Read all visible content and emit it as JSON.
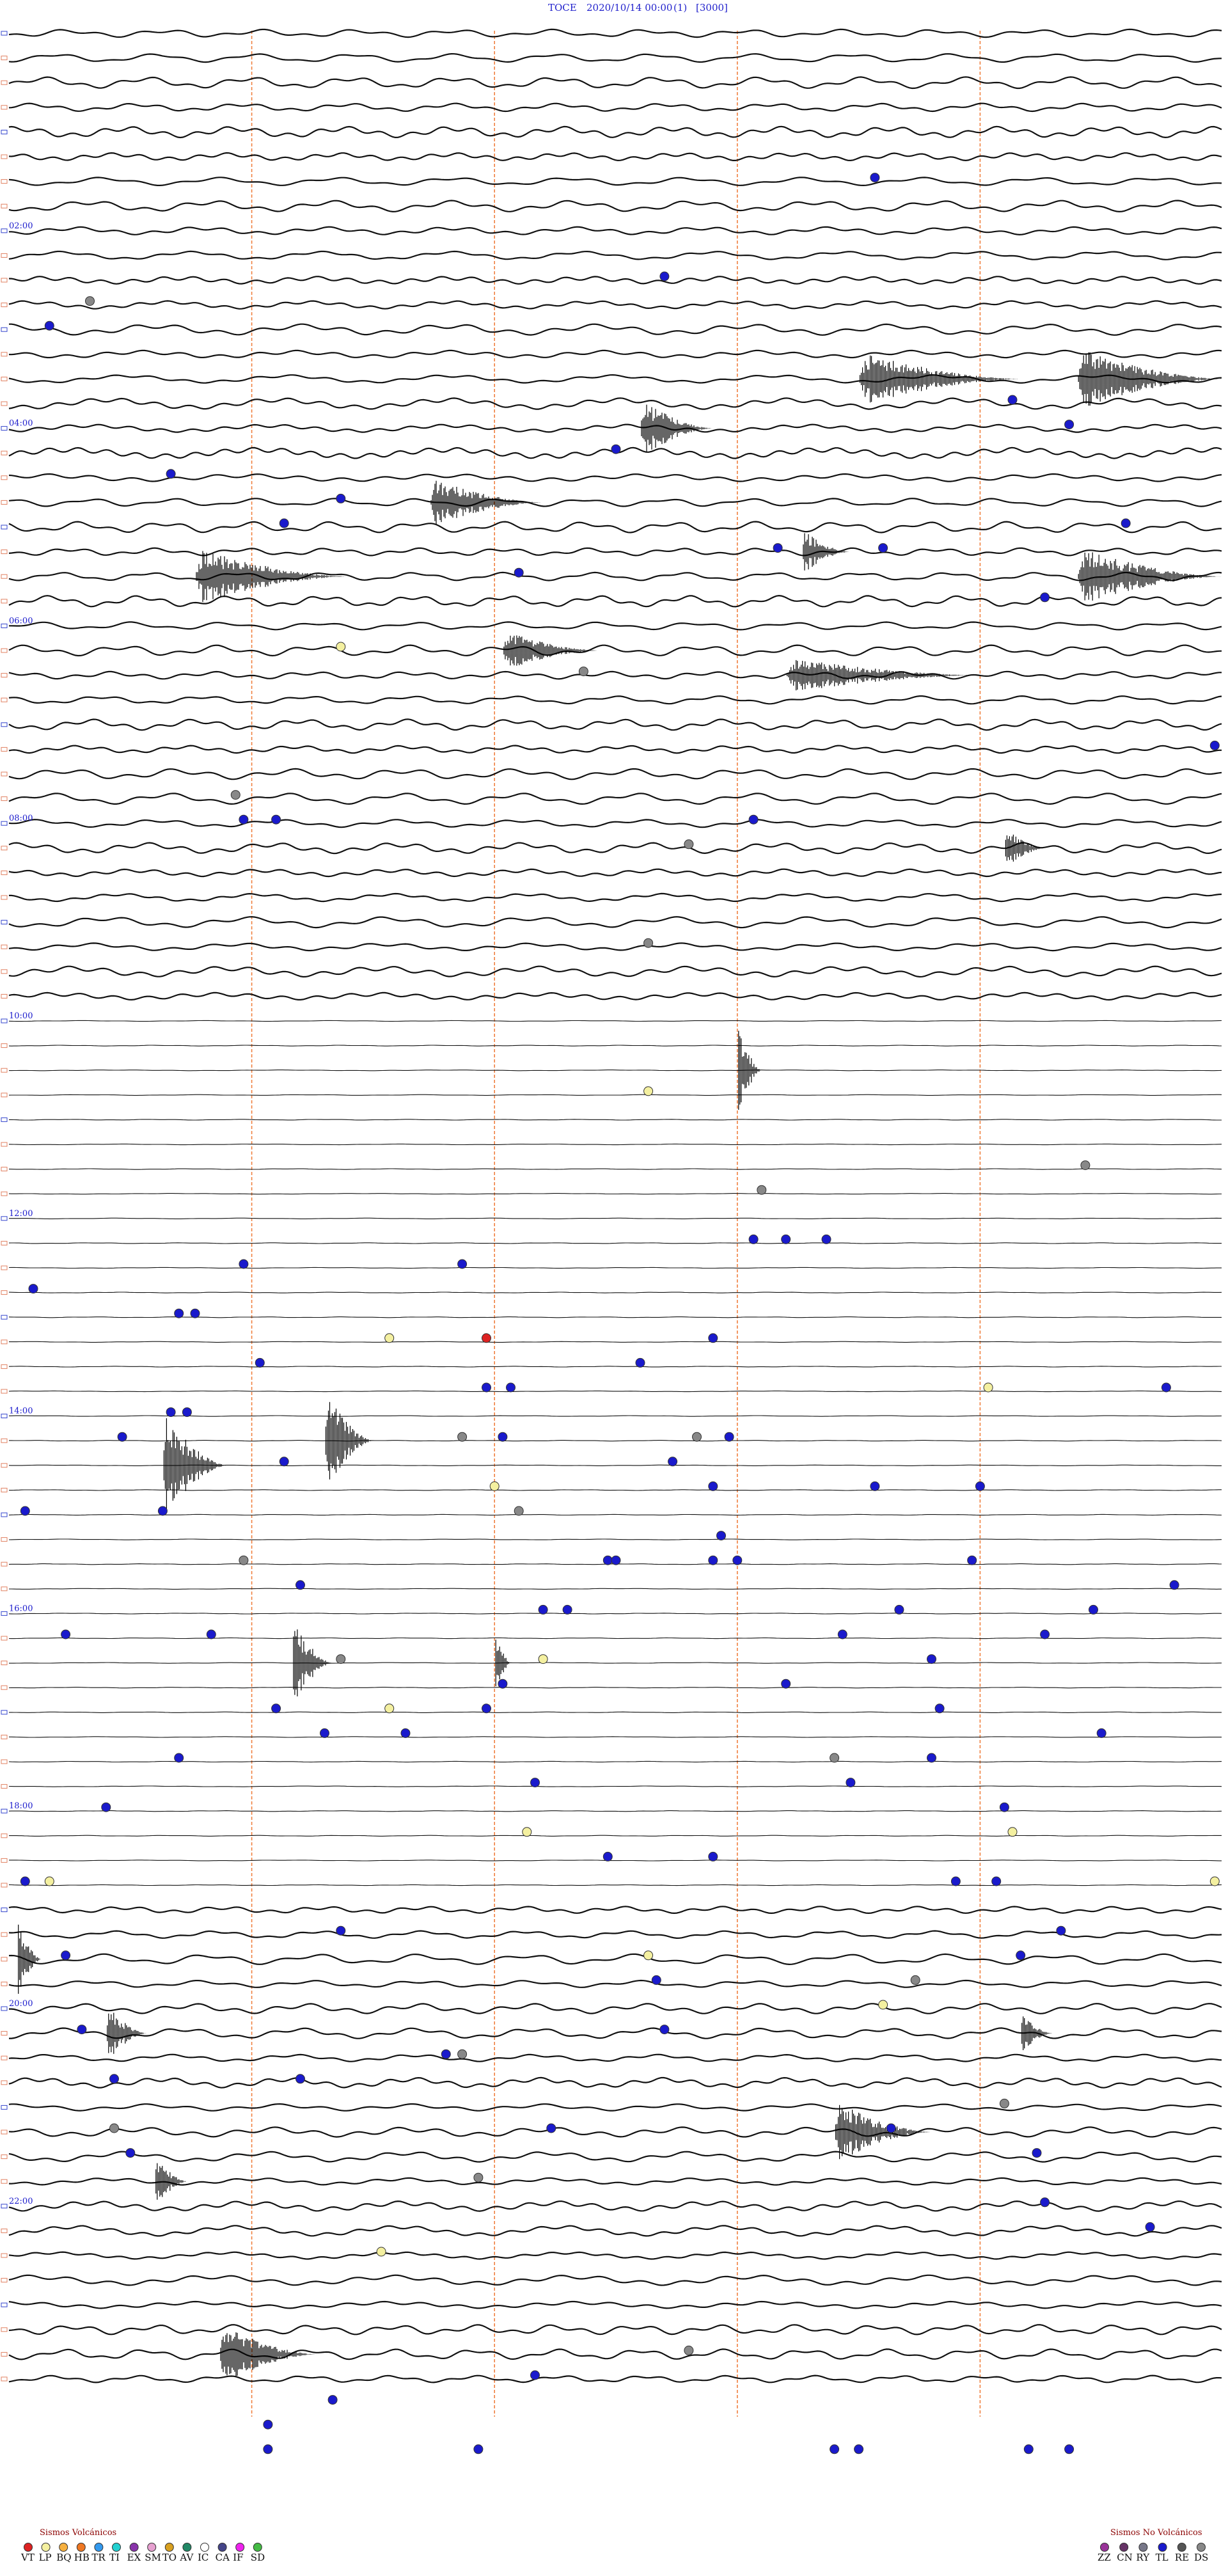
{
  "header": {
    "station": "TOCE",
    "datetime": "2020/10/14 00:00",
    "component": "(1)",
    "scale": "[3000]"
  },
  "chart_data": {
    "type": "helicorder",
    "rows": 96,
    "minutes_per_row": 15,
    "hour_labels": [
      {
        "row": 8,
        "text": "02:00"
      },
      {
        "row": 16,
        "text": "04:00"
      },
      {
        "row": 24,
        "text": "06:00"
      },
      {
        "row": 32,
        "text": "08:00"
      },
      {
        "row": 40,
        "text": "10:00"
      },
      {
        "row": 48,
        "text": "12:00"
      },
      {
        "row": 56,
        "text": "14:00"
      },
      {
        "row": 64,
        "text": "16:00"
      },
      {
        "row": 72,
        "text": "18:00"
      },
      {
        "row": 80,
        "text": "20:00"
      },
      {
        "row": 88,
        "text": "22:00"
      }
    ],
    "vertical_marker_minutes": [
      3,
      6,
      9,
      12
    ],
    "quiet_rows": [
      [
        40,
        75
      ]
    ],
    "bursts": [
      {
        "row": 14,
        "minute": 10.5,
        "span_min": 2.0,
        "amp": 1.2
      },
      {
        "row": 14,
        "minute": 13.2,
        "span_min": 1.8,
        "amp": 1.4
      },
      {
        "row": 16,
        "minute": 7.8,
        "span_min": 0.9,
        "amp": 1.3
      },
      {
        "row": 19,
        "minute": 5.2,
        "span_min": 1.4,
        "amp": 1.1
      },
      {
        "row": 21,
        "minute": 9.8,
        "span_min": 0.6,
        "amp": 1.0
      },
      {
        "row": 22,
        "minute": 2.3,
        "span_min": 1.9,
        "amp": 1.3
      },
      {
        "row": 22,
        "minute": 13.2,
        "span_min": 1.8,
        "amp": 1.3
      },
      {
        "row": 25,
        "minute": 6.1,
        "span_min": 1.2,
        "amp": 0.9
      },
      {
        "row": 26,
        "minute": 9.6,
        "span_min": 2.4,
        "amp": 0.8
      },
      {
        "row": 33,
        "minute": 12.3,
        "span_min": 0.5,
        "amp": 1.0
      },
      {
        "row": 42,
        "minute": 9.0,
        "span_min": 0.3,
        "amp": 2.2
      },
      {
        "row": 57,
        "minute": 3.9,
        "span_min": 0.6,
        "amp": 2.6
      },
      {
        "row": 58,
        "minute": 1.9,
        "span_min": 0.8,
        "amp": 2.4
      },
      {
        "row": 66,
        "minute": 3.5,
        "span_min": 0.5,
        "amp": 2.0
      },
      {
        "row": 66,
        "minute": 6.0,
        "span_min": 0.2,
        "amp": 2.0
      },
      {
        "row": 78,
        "minute": 0.1,
        "span_min": 0.3,
        "amp": 2.0
      },
      {
        "row": 81,
        "minute": 1.2,
        "span_min": 0.5,
        "amp": 1.3
      },
      {
        "row": 81,
        "minute": 12.5,
        "span_min": 0.4,
        "amp": 0.9
      },
      {
        "row": 85,
        "minute": 10.2,
        "span_min": 1.2,
        "amp": 1.4
      },
      {
        "row": 87,
        "minute": 1.8,
        "span_min": 0.4,
        "amp": 1.3
      },
      {
        "row": 94,
        "minute": 2.6,
        "span_min": 1.2,
        "amp": 1.4
      }
    ],
    "events": [
      {
        "row": 6,
        "minute": 10.7,
        "type": "TL"
      },
      {
        "row": 10,
        "minute": 8.1,
        "type": "TL"
      },
      {
        "row": 11,
        "minute": 1.0,
        "type": "DS"
      },
      {
        "row": 12,
        "minute": 0.5,
        "type": "TL"
      },
      {
        "row": 15,
        "minute": 12.4,
        "type": "TL"
      },
      {
        "row": 16,
        "minute": 13.1,
        "type": "TL"
      },
      {
        "row": 17,
        "minute": 7.5,
        "type": "TL"
      },
      {
        "row": 18,
        "minute": 2.0,
        "type": "TL"
      },
      {
        "row": 19,
        "minute": 4.1,
        "type": "TL"
      },
      {
        "row": 20,
        "minute": 3.4,
        "type": "TL"
      },
      {
        "row": 20,
        "minute": 13.8,
        "type": "TL"
      },
      {
        "row": 21,
        "minute": 9.5,
        "type": "TL"
      },
      {
        "row": 21,
        "minute": 10.8,
        "type": "TL"
      },
      {
        "row": 22,
        "minute": 6.3,
        "type": "TL"
      },
      {
        "row": 23,
        "minute": 12.8,
        "type": "TL"
      },
      {
        "row": 25,
        "minute": 4.1,
        "type": "LP"
      },
      {
        "row": 26,
        "minute": 7.1,
        "type": "DS"
      },
      {
        "row": 29,
        "minute": 14.9,
        "type": "TL"
      },
      {
        "row": 31,
        "minute": 2.8,
        "type": "DS"
      },
      {
        "row": 32,
        "minute": 3.3,
        "type": "TL"
      },
      {
        "row": 32,
        "minute": 2.9,
        "type": "TL"
      },
      {
        "row": 32,
        "minute": 9.2,
        "type": "TL"
      },
      {
        "row": 33,
        "minute": 8.4,
        "type": "DS"
      },
      {
        "row": 37,
        "minute": 7.9,
        "type": "DS"
      },
      {
        "row": 43,
        "minute": 7.9,
        "type": "LP"
      },
      {
        "row": 46,
        "minute": 13.3,
        "type": "DS"
      },
      {
        "row": 47,
        "minute": 9.3,
        "type": "DS"
      },
      {
        "row": 49,
        "minute": 9.2,
        "type": "TL"
      },
      {
        "row": 49,
        "minute": 9.6,
        "type": "TL"
      },
      {
        "row": 49,
        "minute": 10.1,
        "type": "TL"
      },
      {
        "row": 50,
        "minute": 2.9,
        "type": "TL"
      },
      {
        "row": 50,
        "minute": 5.6,
        "type": "TL"
      },
      {
        "row": 51,
        "minute": 0.3,
        "type": "TL"
      },
      {
        "row": 52,
        "minute": 2.1,
        "type": "TL"
      },
      {
        "row": 52,
        "minute": 2.3,
        "type": "TL"
      },
      {
        "row": 53,
        "minute": 4.7,
        "type": "LP"
      },
      {
        "row": 53,
        "minute": 5.9,
        "type": "VT"
      },
      {
        "row": 53,
        "minute": 8.7,
        "type": "TL"
      },
      {
        "row": 54,
        "minute": 3.1,
        "type": "TL"
      },
      {
        "row": 54,
        "minute": 7.8,
        "type": "TL"
      },
      {
        "row": 55,
        "minute": 12.1,
        "type": "LP"
      },
      {
        "row": 55,
        "minute": 5.9,
        "type": "TL"
      },
      {
        "row": 55,
        "minute": 6.2,
        "type": "TL"
      },
      {
        "row": 55,
        "minute": 14.3,
        "type": "TL"
      },
      {
        "row": 56,
        "minute": 2.0,
        "type": "TL"
      },
      {
        "row": 56,
        "minute": 2.2,
        "type": "TL"
      },
      {
        "row": 57,
        "minute": 1.4,
        "type": "TL"
      },
      {
        "row": 57,
        "minute": 5.6,
        "type": "DS"
      },
      {
        "row": 57,
        "minute": 6.1,
        "type": "TL"
      },
      {
        "row": 57,
        "minute": 8.5,
        "type": "DS"
      },
      {
        "row": 57,
        "minute": 8.9,
        "type": "TL"
      },
      {
        "row": 58,
        "minute": 3.4,
        "type": "TL"
      },
      {
        "row": 58,
        "minute": 8.2,
        "type": "TL"
      },
      {
        "row": 59,
        "minute": 6.0,
        "type": "LP"
      },
      {
        "row": 59,
        "minute": 8.7,
        "type": "TL"
      },
      {
        "row": 59,
        "minute": 10.7,
        "type": "TL"
      },
      {
        "row": 59,
        "minute": 12.0,
        "type": "TL"
      },
      {
        "row": 60,
        "minute": 0.2,
        "type": "TL"
      },
      {
        "row": 60,
        "minute": 1.9,
        "type": "TL"
      },
      {
        "row": 60,
        "minute": 6.3,
        "type": "DS"
      },
      {
        "row": 61,
        "minute": 8.8,
        "type": "TL"
      },
      {
        "row": 62,
        "minute": 2.9,
        "type": "DS"
      },
      {
        "row": 62,
        "minute": 7.4,
        "type": "TL"
      },
      {
        "row": 62,
        "minute": 7.5,
        "type": "TL"
      },
      {
        "row": 62,
        "minute": 8.7,
        "type": "TL"
      },
      {
        "row": 62,
        "minute": 9.0,
        "type": "TL"
      },
      {
        "row": 62,
        "minute": 11.9,
        "type": "TL"
      },
      {
        "row": 63,
        "minute": 3.6,
        "type": "TL"
      },
      {
        "row": 63,
        "minute": 14.4,
        "type": "TL"
      },
      {
        "row": 64,
        "minute": 6.6,
        "type": "TL"
      },
      {
        "row": 64,
        "minute": 6.9,
        "type": "TL"
      },
      {
        "row": 64,
        "minute": 11.0,
        "type": "TL"
      },
      {
        "row": 64,
        "minute": 13.4,
        "type": "TL"
      },
      {
        "row": 65,
        "minute": 0.7,
        "type": "TL"
      },
      {
        "row": 65,
        "minute": 2.5,
        "type": "TL"
      },
      {
        "row": 65,
        "minute": 10.3,
        "type": "TL"
      },
      {
        "row": 65,
        "minute": 12.8,
        "type": "TL"
      },
      {
        "row": 66,
        "minute": 4.1,
        "type": "DS"
      },
      {
        "row": 66,
        "minute": 6.6,
        "type": "LP"
      },
      {
        "row": 66,
        "minute": 11.4,
        "type": "TL"
      },
      {
        "row": 67,
        "minute": 6.1,
        "type": "TL"
      },
      {
        "row": 67,
        "minute": 9.6,
        "type": "TL"
      },
      {
        "row": 68,
        "minute": 3.3,
        "type": "TL"
      },
      {
        "row": 68,
        "minute": 4.7,
        "type": "LP"
      },
      {
        "row": 68,
        "minute": 5.9,
        "type": "TL"
      },
      {
        "row": 68,
        "minute": 11.5,
        "type": "TL"
      },
      {
        "row": 69,
        "minute": 3.9,
        "type": "TL"
      },
      {
        "row": 69,
        "minute": 4.9,
        "type": "TL"
      },
      {
        "row": 69,
        "minute": 13.5,
        "type": "TL"
      },
      {
        "row": 70,
        "minute": 2.1,
        "type": "TL"
      },
      {
        "row": 70,
        "minute": 10.2,
        "type": "DS"
      },
      {
        "row": 70,
        "minute": 11.4,
        "type": "TL"
      },
      {
        "row": 71,
        "minute": 6.5,
        "type": "TL"
      },
      {
        "row": 71,
        "minute": 10.4,
        "type": "TL"
      },
      {
        "row": 72,
        "minute": 1.2,
        "type": "TL"
      },
      {
        "row": 72,
        "minute": 12.3,
        "type": "TL"
      },
      {
        "row": 73,
        "minute": 6.4,
        "type": "LP"
      },
      {
        "row": 73,
        "minute": 12.4,
        "type": "LP"
      },
      {
        "row": 74,
        "minute": 7.4,
        "type": "TL"
      },
      {
        "row": 74,
        "minute": 8.7,
        "type": "TL"
      },
      {
        "row": 75,
        "minute": 0.2,
        "type": "TL"
      },
      {
        "row": 75,
        "minute": 0.5,
        "type": "LP"
      },
      {
        "row": 75,
        "minute": 11.7,
        "type": "TL"
      },
      {
        "row": 75,
        "minute": 12.2,
        "type": "TL"
      },
      {
        "row": 75,
        "minute": 14.9,
        "type": "LP"
      },
      {
        "row": 77,
        "minute": 4.1,
        "type": "TL"
      },
      {
        "row": 77,
        "minute": 13.0,
        "type": "TL"
      },
      {
        "row": 78,
        "minute": 0.7,
        "type": "TL"
      },
      {
        "row": 78,
        "minute": 7.9,
        "type": "LP"
      },
      {
        "row": 78,
        "minute": 12.5,
        "type": "TL"
      },
      {
        "row": 79,
        "minute": 8.0,
        "type": "TL"
      },
      {
        "row": 79,
        "minute": 11.2,
        "type": "DS"
      },
      {
        "row": 80,
        "minute": 10.8,
        "type": "LP"
      },
      {
        "row": 81,
        "minute": 0.9,
        "type": "TL"
      },
      {
        "row": 81,
        "minute": 8.1,
        "type": "TL"
      },
      {
        "row": 82,
        "minute": 5.4,
        "type": "TL"
      },
      {
        "row": 82,
        "minute": 5.6,
        "type": "DS"
      },
      {
        "row": 83,
        "minute": 1.3,
        "type": "TL"
      },
      {
        "row": 83,
        "minute": 3.6,
        "type": "TL"
      },
      {
        "row": 84,
        "minute": 12.3,
        "type": "DS"
      },
      {
        "row": 85,
        "minute": 1.3,
        "type": "DS"
      },
      {
        "row": 85,
        "minute": 6.7,
        "type": "TL"
      },
      {
        "row": 85,
        "minute": 10.9,
        "type": "TL"
      },
      {
        "row": 86,
        "minute": 1.5,
        "type": "TL"
      },
      {
        "row": 86,
        "minute": 12.7,
        "type": "TL"
      },
      {
        "row": 87,
        "minute": 5.8,
        "type": "DS"
      },
      {
        "row": 88,
        "minute": 12.8,
        "type": "TL"
      },
      {
        "row": 89,
        "minute": 14.1,
        "type": "TL"
      },
      {
        "row": 90,
        "minute": 4.6,
        "type": "LP"
      },
      {
        "row": 94,
        "minute": 8.4,
        "type": "DS"
      },
      {
        "row": 95,
        "minute": 6.5,
        "type": "TL"
      },
      {
        "row": 96,
        "minute": 4.0,
        "type": "TL"
      },
      {
        "row": 97,
        "minute": 3.2,
        "type": "TL"
      },
      {
        "row": 98,
        "minute": 3.2,
        "type": "TL"
      },
      {
        "row": 98,
        "minute": 5.8,
        "type": "TL"
      },
      {
        "row": 98,
        "minute": 10.2,
        "type": "TL"
      },
      {
        "row": 98,
        "minute": 10.5,
        "type": "TL"
      },
      {
        "row": 98,
        "minute": 12.6,
        "type": "TL"
      },
      {
        "row": 98,
        "minute": 13.1,
        "type": "TL"
      }
    ],
    "legend": {
      "volcanic_title": "Sismos Volcánicos",
      "non_volcanic_title": "Sismos No Volcánicos",
      "volcanic": [
        {
          "code": "VT",
          "color": "#dd2222"
        },
        {
          "code": "LP",
          "color": "#f4f0a0"
        },
        {
          "code": "BQ",
          "color": "#f6b040"
        },
        {
          "code": "HB",
          "color": "#ee7722"
        },
        {
          "code": "TR",
          "color": "#3399ee"
        },
        {
          "code": "TI",
          "color": "#22d0d0"
        },
        {
          "code": "EX",
          "color": "#8833aa"
        },
        {
          "code": "SM",
          "color": "#e6a0d0"
        },
        {
          "code": "TO",
          "color": "#d8a020"
        },
        {
          "code": "AV",
          "color": "#228866"
        },
        {
          "code": "IC",
          "color": "#ffffff"
        },
        {
          "code": "CA",
          "color": "#444488"
        },
        {
          "code": "IF",
          "color": "#ee22ee"
        },
        {
          "code": "SD",
          "color": "#44bb44"
        }
      ],
      "non_volcanic": [
        {
          "code": "ZZ",
          "color": "#993399"
        },
        {
          "code": "CN",
          "color": "#663366"
        },
        {
          "code": "RY",
          "color": "#777788"
        },
        {
          "code": "TL",
          "color": "#1a1acc"
        },
        {
          "code": "RE",
          "color": "#555555"
        },
        {
          "code": "DS",
          "color": "#888888"
        }
      ]
    }
  }
}
